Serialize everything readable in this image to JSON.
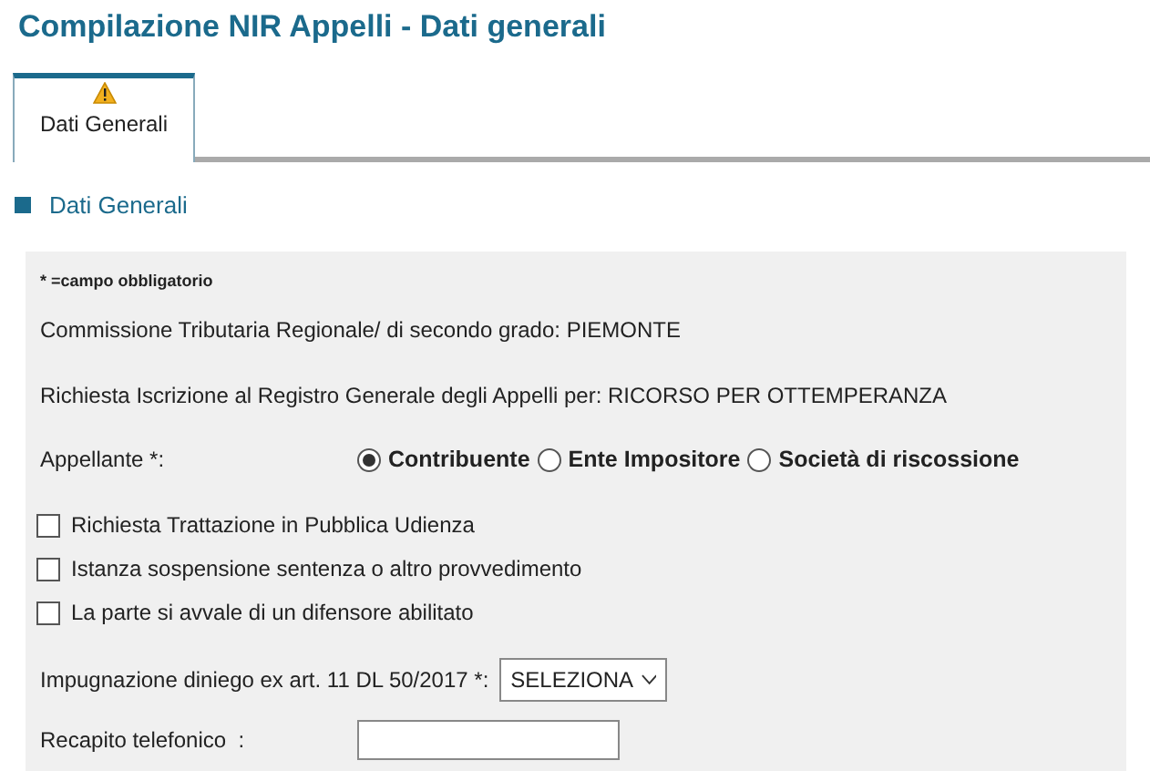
{
  "title": "Compilazione NIR Appelli - Dati generali",
  "tabs": [
    {
      "label": "Dati Generali",
      "selected": true,
      "warning": true
    }
  ],
  "section": {
    "title": "Dati Generali"
  },
  "form": {
    "note": "* =campo obbligatorio",
    "info": [
      "Commissione Tributaria Regionale/ di secondo grado: PIEMONTE",
      "Richiesta Iscrizione al Registro Generale degli Appelli per: RICORSO PER OTTEMPERANZA"
    ],
    "appellante": {
      "label": "Appellante *:",
      "options": [
        {
          "label": "Contribuente",
          "selected": true
        },
        {
          "label": "Ente Impositore",
          "selected": false
        },
        {
          "label": "Società di riscossione",
          "selected": false
        }
      ]
    },
    "checkboxes": [
      {
        "label": "Richiesta Trattazione in Pubblica Udienza",
        "checked": false
      },
      {
        "label": "Istanza sospensione sentenza o altro provvedimento",
        "checked": false
      },
      {
        "label": "La parte si avvale di un difensore abilitato",
        "checked": false
      }
    ],
    "impugnazione": {
      "label": "Impugnazione diniego ex art. 11 DL 50/2017 *:",
      "value": "SELEZIONA"
    },
    "recapito": {
      "label": "Recapito telefonico  :"
    }
  }
}
